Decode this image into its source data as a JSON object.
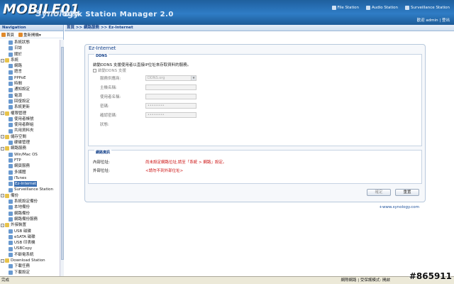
{
  "header": {
    "logo": "MOBILE01",
    "logo_overlay": "Synology",
    "app_title": "Disk Station Manager 2.0",
    "links": [
      "File Station",
      "Audio Station",
      "Surveillance Station"
    ],
    "user_line": "歡迎 admin | 登出"
  },
  "nav": {
    "title": "Navigation",
    "tools": [
      "首頁",
      "重新開機▾"
    ],
    "items": [
      {
        "label": "系統狀態",
        "level": 2,
        "folder": false
      },
      {
        "label": "日誌",
        "level": 2,
        "folder": false
      },
      {
        "label": "關於",
        "level": 2,
        "folder": false
      },
      {
        "label": "系統",
        "level": 1,
        "folder": true
      },
      {
        "label": "網路",
        "level": 2,
        "folder": false
      },
      {
        "label": "語言",
        "level": 2,
        "folder": false
      },
      {
        "label": "PPPoE",
        "level": 2,
        "folder": false
      },
      {
        "label": "時間",
        "level": 2,
        "folder": false
      },
      {
        "label": "通知設定",
        "level": 2,
        "folder": false
      },
      {
        "label": "電源",
        "level": 2,
        "folder": false
      },
      {
        "label": "回復設定",
        "level": 2,
        "folder": false
      },
      {
        "label": "系統更新",
        "level": 2,
        "folder": false
      },
      {
        "label": "權限管理",
        "level": 1,
        "folder": true
      },
      {
        "label": "使用者帳號",
        "level": 2,
        "folder": false
      },
      {
        "label": "使用者群組",
        "level": 2,
        "folder": false
      },
      {
        "label": "共用資料夾",
        "level": 2,
        "folder": false
      },
      {
        "label": "儲存空間",
        "level": 1,
        "folder": true
      },
      {
        "label": "硬碟管理",
        "level": 2,
        "folder": false
      },
      {
        "label": "網路服務",
        "level": 1,
        "folder": true
      },
      {
        "label": "Win/Mac OS",
        "level": 2,
        "folder": false
      },
      {
        "label": "FTP",
        "level": 2,
        "folder": false
      },
      {
        "label": "網頁服務",
        "level": 2,
        "folder": false
      },
      {
        "label": "多媒體",
        "level": 2,
        "folder": false
      },
      {
        "label": "iTunes",
        "level": 2,
        "folder": false
      },
      {
        "label": "Ez-Internet",
        "level": 2,
        "folder": false,
        "selected": true
      },
      {
        "label": "Surveillance Station",
        "level": 2,
        "folder": false
      },
      {
        "label": "備份",
        "level": 1,
        "folder": true
      },
      {
        "label": "系統設定備份",
        "level": 2,
        "folder": false
      },
      {
        "label": "本地備份",
        "level": 2,
        "folder": false
      },
      {
        "label": "網路備份",
        "level": 2,
        "folder": false
      },
      {
        "label": "網路備份服務",
        "level": 2,
        "folder": false
      },
      {
        "label": "外接裝置",
        "level": 1,
        "folder": true
      },
      {
        "label": "USB 磁碟",
        "level": 2,
        "folder": false
      },
      {
        "label": "eSATA 磁碟",
        "level": 2,
        "folder": false
      },
      {
        "label": "USB 印表機",
        "level": 2,
        "folder": false
      },
      {
        "label": "USBCopy",
        "level": 2,
        "folder": false
      },
      {
        "label": "不斷電系統",
        "level": 2,
        "folder": false
      },
      {
        "label": "Download Station",
        "level": 1,
        "folder": true
      },
      {
        "label": "下載任務",
        "level": 2,
        "folder": false
      },
      {
        "label": "下載設定",
        "level": 2,
        "folder": false
      }
    ]
  },
  "main": {
    "breadcrumb": "首頁 >> 網路服務 >> Ez-Internet",
    "panel_title": "Ez-Internet",
    "ddns": {
      "legend": "DDNS",
      "description": "啟動DDNS 支援使用者以直接IP位址來存取資料的服務。",
      "enable_label": "啟動DDNS 支援",
      "fields": [
        {
          "label": "服務供應商:",
          "value": "DDNS.org",
          "type": "select"
        },
        {
          "label": "主機名稱:",
          "value": "",
          "type": "text"
        },
        {
          "label": "使用者名稱:",
          "value": "",
          "type": "text"
        },
        {
          "label": "密碼:",
          "value": "••••••••",
          "type": "text"
        },
        {
          "label": "確認密碼:",
          "value": "••••••••",
          "type": "text"
        },
        {
          "label": "狀態:",
          "value": "",
          "type": "static"
        }
      ]
    },
    "network": {
      "legend": "網路資訊",
      "rows": [
        {
          "label": "內部位址:",
          "value": "尚未設定網路位址,請至「系統 > 網路」設定。"
        },
        {
          "label": "外部位址:",
          "value": "<請勿不到外部位址>"
        }
      ]
    },
    "buttons": {
      "apply": "確定",
      "reset": "重置"
    },
    "link": "www.synology.com"
  },
  "status": {
    "left": "完成",
    "right": "網際網路 | 受保護模式: 開啟",
    "watermark": "#865911"
  }
}
